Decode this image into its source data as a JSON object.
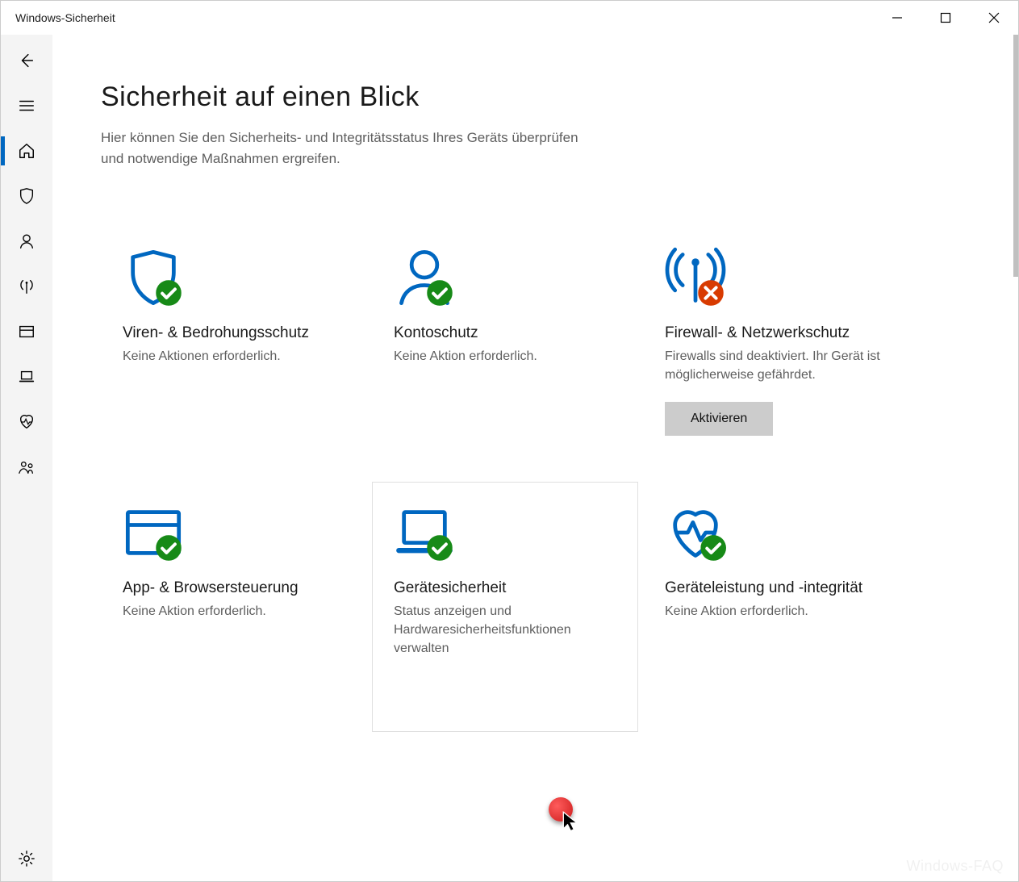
{
  "window": {
    "title": "Windows-Sicherheit"
  },
  "page": {
    "title": "Sicherheit auf einen Blick",
    "subtitle": "Hier können Sie den Sicherheits- und Integritätsstatus Ihres Geräts überprüfen und notwendige Maßnahmen ergreifen."
  },
  "sidebar": {
    "items": [
      {
        "id": "back",
        "icon": "back-icon"
      },
      {
        "id": "menu",
        "icon": "hamburger-icon"
      },
      {
        "id": "home",
        "icon": "home-icon",
        "selected": true
      },
      {
        "id": "virus",
        "icon": "shield-icon"
      },
      {
        "id": "account",
        "icon": "person-icon"
      },
      {
        "id": "firewall",
        "icon": "antenna-icon"
      },
      {
        "id": "app",
        "icon": "window-icon"
      },
      {
        "id": "device",
        "icon": "laptop-icon"
      },
      {
        "id": "health",
        "icon": "heart-icon"
      },
      {
        "id": "family",
        "icon": "family-icon"
      }
    ]
  },
  "cards": [
    {
      "id": "virus",
      "title": "Viren- & Bedrohungsschutz",
      "desc": "Keine Aktionen erforderlich.",
      "status": "ok",
      "icon": "shield-icon"
    },
    {
      "id": "account",
      "title": "Kontoschutz",
      "desc": "Keine Aktion erforderlich.",
      "status": "ok",
      "icon": "person-icon"
    },
    {
      "id": "firewall",
      "title": "Firewall- & Netzwerkschutz",
      "desc": "Firewalls sind deaktiviert. Ihr Gerät ist möglicherweise gefährdet.",
      "status": "error",
      "icon": "antenna-icon",
      "action": "Aktivieren"
    },
    {
      "id": "app",
      "title": "App- & Browsersteuerung",
      "desc": "Keine Aktion erforderlich.",
      "status": "ok",
      "icon": "window-icon"
    },
    {
      "id": "device",
      "title": "Gerätesicherheit",
      "desc": "Status anzeigen und Hardwaresicherheitsfunktionen verwalten",
      "status": "ok",
      "icon": "laptop-icon",
      "hovered": true
    },
    {
      "id": "health",
      "title": "Geräteleistung und -integrität",
      "desc": "Keine Aktion erforderlich.",
      "status": "ok",
      "icon": "heart-icon"
    }
  ],
  "watermark": "Windows-FAQ",
  "colors": {
    "accent": "#0067c0",
    "ok": "#178a17",
    "error": "#d83b01"
  }
}
